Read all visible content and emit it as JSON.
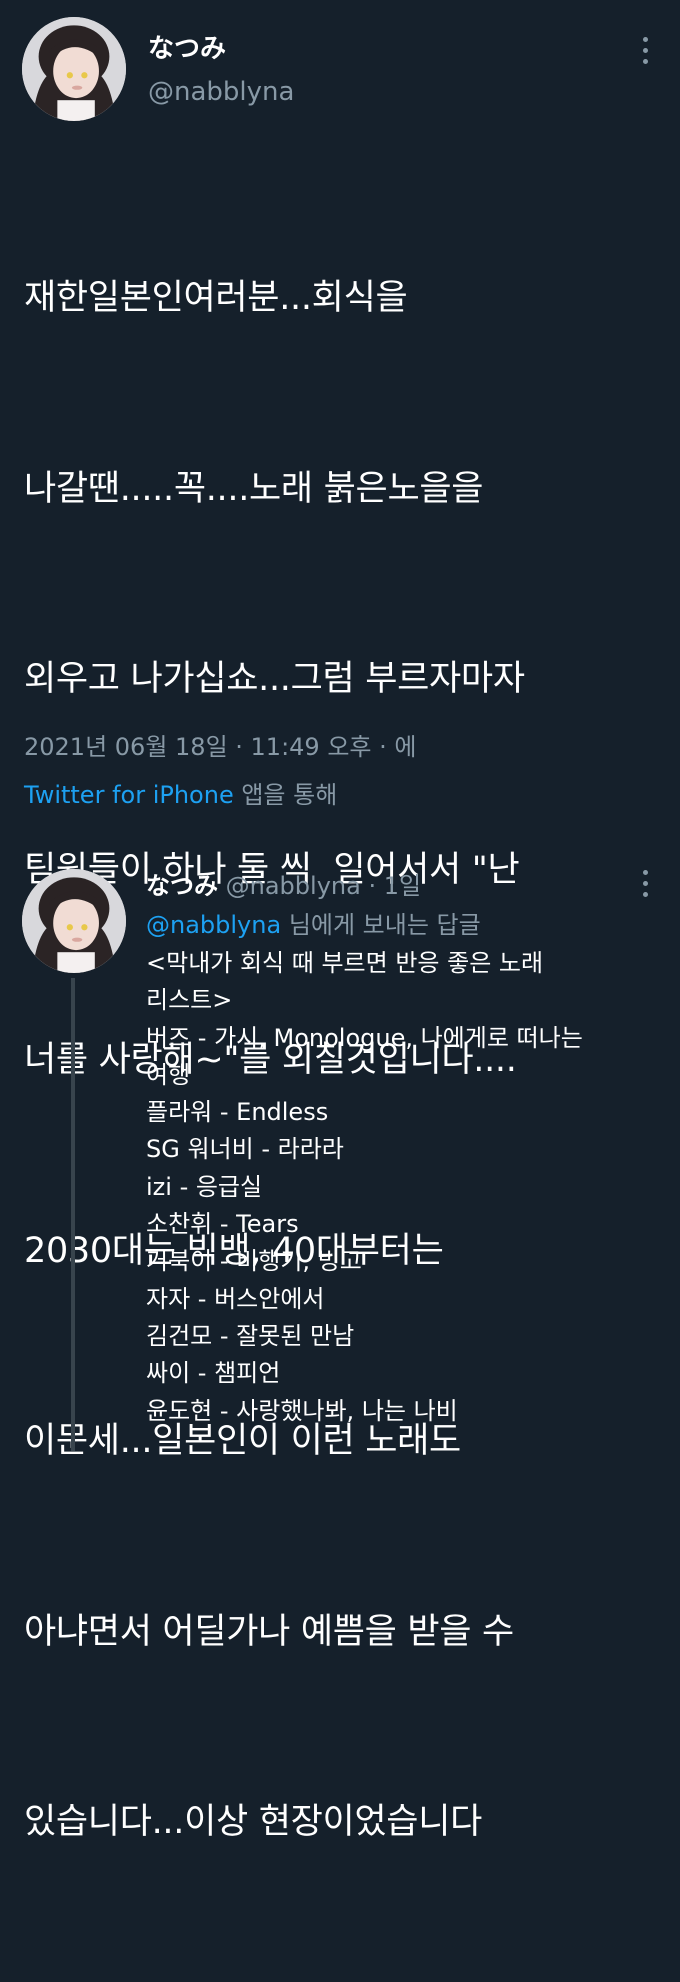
{
  "main_tweet": {
    "display_name": "なつみ",
    "handle": "@nabblyna",
    "text_lines": [
      "재한일본인여러분...회식을",
      "나갈땐.....꼭....노래 붉은노을을",
      "외우고 나가십쇼...그럼 부르자마자",
      "팀원들이 하나 둘 씩  일어서서 \"난",
      "너를 사랑해~\"를 외칠것입니다....",
      "2030대는 빅뱅, 40대부터는",
      "이문세...일본인이 이런 노래도",
      "아냐면서 어딜가나 예쁨을 받을 수",
      "있습니다...이상 현장이었습니다"
    ],
    "timestamp": "2021년 06월 18일 · 11:49 오후 · 에",
    "source_app": "Twitter for iPhone",
    "source_suffix": " 앱을 통해"
  },
  "reply_tweet": {
    "display_name": "なつみ",
    "handle": "@nabblyna",
    "separator": " · ",
    "time_ago": "1일",
    "replying_mention": "@nabblyna",
    "replying_suffix": " 님에게 보내는 답글",
    "body_lines": [
      "<막내가 회식 때 부르면 반응 좋은 노래",
      "리스트>",
      "버즈 - 가시, Monologue, 나에게로 떠나는",
      "여행",
      "플라워 - Endless",
      "SG 워너비 - 라라라",
      "izi - 응급실",
      "소찬휘 - Tears",
      "거북이 - 비행기, 빙고",
      "자자 - 버스안에서",
      "김건모 - 잘못된 만남",
      "싸이 - 챔피언",
      "윤도현 - 사랑했나봐, 나는 나비"
    ]
  },
  "icons": {
    "more": "more-vertical-icon"
  },
  "colors": {
    "background": "#15202b",
    "primary_text": "#ffffff",
    "secondary_text": "#8899a6",
    "link": "#1da1f2",
    "thread_line": "#38444d"
  }
}
